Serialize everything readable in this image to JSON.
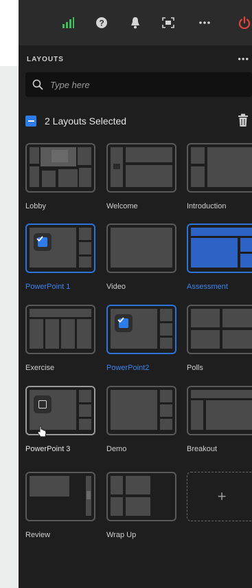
{
  "colors": {
    "accent": "#2d7ce8",
    "panel": "#1e1e1e",
    "topbar": "#2b2b2b",
    "power": "#e5433b",
    "signal": "#3fbf5a"
  },
  "topbar": {
    "icons": [
      "signal-icon",
      "help-icon",
      "bell-icon",
      "screen-capture-icon",
      "more-icon",
      "power-icon"
    ]
  },
  "layouts": {
    "header": "LAYOUTS",
    "more": "•••",
    "search": {
      "placeholder": "Type here",
      "value": ""
    },
    "selection": {
      "label": "2 Layouts Selected",
      "state": "indeterminate"
    },
    "items": [
      {
        "label": "Lobby",
        "selected": false
      },
      {
        "label": "Welcome",
        "selected": false
      },
      {
        "label": "Introduction",
        "selected": false
      },
      {
        "label": "PowerPoint 1",
        "selected": true
      },
      {
        "label": "Video",
        "selected": false
      },
      {
        "label": "Assessment",
        "selected": true
      },
      {
        "label": "Exercise",
        "selected": false
      },
      {
        "label": "PowerPoint2",
        "selected": true
      },
      {
        "label": "Polls",
        "selected": false
      },
      {
        "label": "PowerPoint 3",
        "selected": false
      },
      {
        "label": "Demo",
        "selected": false
      },
      {
        "label": "Breakout",
        "selected": false
      },
      {
        "label": "Review",
        "selected": false
      },
      {
        "label": "Wrap Up",
        "selected": false
      }
    ],
    "add_label": "+"
  }
}
